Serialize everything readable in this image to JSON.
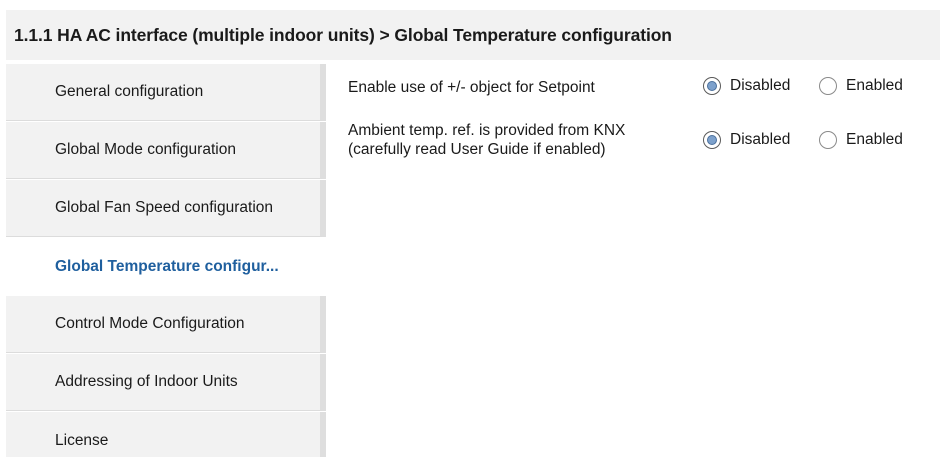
{
  "header": {
    "title": "1.1.1 HA AC interface (multiple indoor units) > Global Temperature configuration"
  },
  "sidebar": {
    "items": [
      {
        "label": "General configuration",
        "active": false
      },
      {
        "label": "Global Mode configuration",
        "active": false
      },
      {
        "label": "Global Fan Speed configuration",
        "active": false
      },
      {
        "label": "Global Temperature configur...",
        "active": true
      },
      {
        "label": "Control Mode Configuration",
        "active": false
      },
      {
        "label": "Addressing of Indoor Units",
        "active": false
      },
      {
        "label": "License",
        "active": false
      }
    ]
  },
  "parameters": [
    {
      "label_line1": "Enable use of +/- object for Setpoint",
      "label_line2": "",
      "options": [
        "Disabled",
        "Enabled"
      ],
      "selected": "Disabled"
    },
    {
      "label_line1": "Ambient temp. ref. is provided from KNX",
      "label_line2": "(carefully read User Guide if enabled)",
      "options": [
        "Disabled",
        "Enabled"
      ],
      "selected": "Disabled"
    }
  ],
  "colors": {
    "active_text": "#1f5f9e",
    "radio_fill": "#7da1cc",
    "panel_bg": "#f2f2f2"
  }
}
